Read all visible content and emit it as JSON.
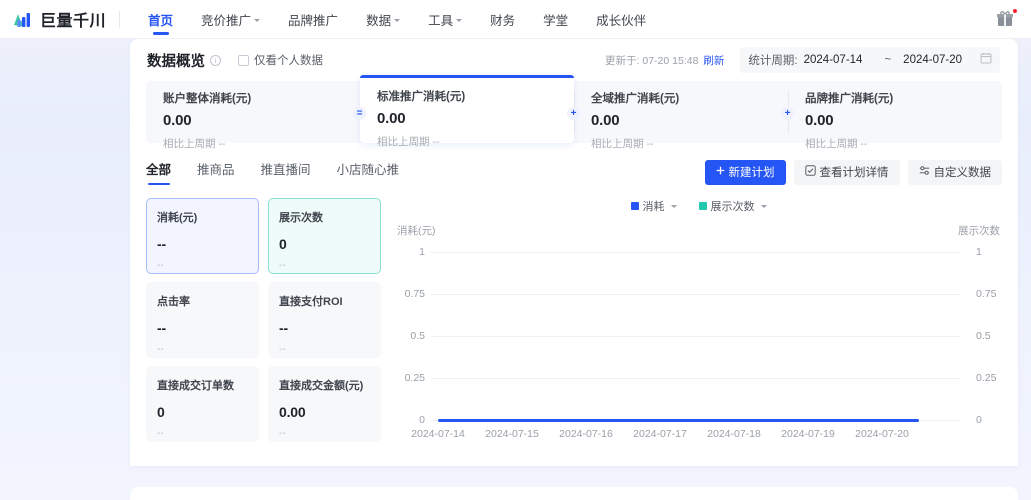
{
  "brand": {
    "name": "巨量千川",
    "logo_icon": "bar-chart-logo-icon"
  },
  "nav": {
    "items": [
      {
        "label": "首页",
        "active": true,
        "dropdown": false
      },
      {
        "label": "竞价推广",
        "active": false,
        "dropdown": true
      },
      {
        "label": "品牌推广",
        "active": false,
        "dropdown": false
      },
      {
        "label": "数据",
        "active": false,
        "dropdown": true
      },
      {
        "label": "工具",
        "active": false,
        "dropdown": true
      },
      {
        "label": "财务",
        "active": false,
        "dropdown": false
      },
      {
        "label": "学堂",
        "active": false,
        "dropdown": false
      },
      {
        "label": "成长伙伴",
        "active": false,
        "dropdown": false
      }
    ],
    "gift_icon": "gift-icon"
  },
  "panel_header": {
    "title": "数据概览",
    "info_icon": "info-icon",
    "checkbox_label": "仅看个人数据",
    "checkbox_checked": false,
    "updated_text": "更新于: 07-20 15:48",
    "refresh_label": "刷新",
    "period_label": "统计周期:",
    "date_start": "2024-07-14",
    "date_sep": "~",
    "date_end": "2024-07-20",
    "calendar_icon": "calendar-icon"
  },
  "kpis": [
    {
      "title": "账户整体消耗(元)",
      "value": "0.00",
      "sub": "相比上周期 --",
      "selected": false,
      "op": ""
    },
    {
      "title": "标准推广消耗(元)",
      "value": "0.00",
      "sub": "相比上周期 --",
      "selected": true,
      "op": "="
    },
    {
      "title": "全域推广消耗(元)",
      "value": "0.00",
      "sub": "相比上周期 --",
      "selected": false,
      "op": "+"
    },
    {
      "title": "品牌推广消耗(元)",
      "value": "0.00",
      "sub": "相比上周期 --",
      "selected": false,
      "op": "+"
    }
  ],
  "tabs": [
    {
      "label": "全部",
      "active": true
    },
    {
      "label": "推商品",
      "active": false
    },
    {
      "label": "推直播间",
      "active": false
    },
    {
      "label": "小店随心推",
      "active": false
    }
  ],
  "actions": {
    "new_plan": "新建计划",
    "new_plan_icon": "plus-icon",
    "view_detail": "查看计划详情",
    "view_detail_icon": "checkbox-list-icon",
    "custom_data": "自定义数据",
    "custom_data_icon": "sliders-icon"
  },
  "metric_cards": [
    {
      "title": "消耗(元)",
      "value": "--",
      "sub": "--",
      "state": "selected-blue"
    },
    {
      "title": "展示次数",
      "value": "0",
      "sub": "--",
      "state": "selected-teal"
    },
    {
      "title": "点击率",
      "value": "--",
      "sub": "--",
      "state": "normal"
    },
    {
      "title": "直接支付ROI",
      "value": "--",
      "sub": "--",
      "state": "normal"
    },
    {
      "title": "直接成交订单数",
      "value": "0",
      "sub": "--",
      "state": "normal"
    },
    {
      "title": "直接成交金额(元)",
      "value": "0.00",
      "sub": "--",
      "state": "normal"
    }
  ],
  "colors": {
    "accent": "#2655f5",
    "series_1": "#2655f5",
    "series_2": "#22c8b0",
    "selected_blue_bg": "#f2f4ff",
    "selected_teal_bg": "#effbf8"
  },
  "chart_data": {
    "type": "line",
    "title": "",
    "legend": [
      {
        "name": "消耗",
        "color": "#2655f5",
        "dropdown": true
      },
      {
        "name": "展示次数",
        "color": "#22c8b0",
        "dropdown": true
      }
    ],
    "legend_position": "top-center",
    "grid": true,
    "ylabel": "消耗(元)",
    "y2label": "展示次数",
    "xlabel": "",
    "x": [
      "2024-07-14",
      "2024-07-15",
      "2024-07-16",
      "2024-07-17",
      "2024-07-18",
      "2024-07-19",
      "2024-07-20"
    ],
    "yticks": [
      "1",
      "0.75",
      "0.5",
      "0.25",
      "0"
    ],
    "y2ticks": [
      "1",
      "0.75",
      "0.5",
      "0.25",
      "0"
    ],
    "ylim": [
      0,
      1
    ],
    "y2lim": [
      0,
      1
    ],
    "series": [
      {
        "name": "消耗",
        "color": "#2655f5",
        "axis": "left",
        "values": [
          0,
          0,
          0,
          0,
          0,
          0,
          0
        ]
      },
      {
        "name": "展示次数",
        "color": "#22c8b0",
        "axis": "right",
        "values": [
          0,
          0,
          0,
          0,
          0,
          0,
          0
        ]
      }
    ]
  }
}
